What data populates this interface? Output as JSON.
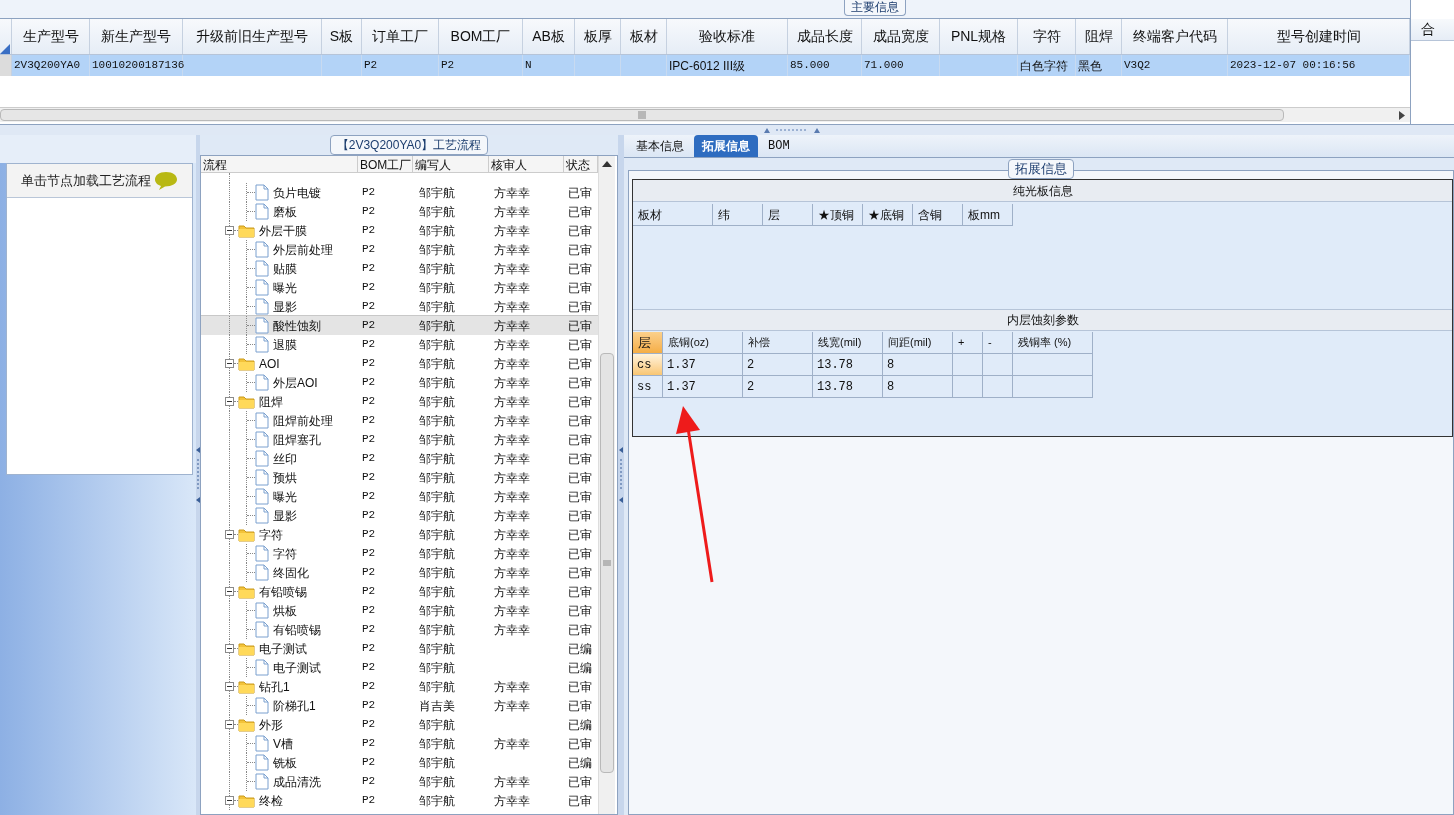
{
  "main_grid": {
    "title": "主要信息",
    "columns": [
      "生产型号",
      "新生产型号",
      "升级前旧生产型号",
      "S板",
      "订单工厂",
      "BOM工厂",
      "AB板",
      "板厚",
      "板材",
      "验收标准",
      "成品长度",
      "成品宽度",
      "PNL规格",
      "字符",
      "阻焊",
      "终端客户代码",
      "型号创建时间"
    ],
    "rows": [
      {
        "selected": true,
        "cells": [
          {
            "text": "2V3Q200YA0"
          },
          {
            "text": "10010200187136"
          },
          {},
          {},
          {
            "text": "P2"
          },
          {
            "text": "P2"
          },
          {
            "text": "N"
          },
          {},
          {},
          {
            "text": "IPC-6012 III级"
          },
          {
            "text": "85.000"
          },
          {
            "text": "71.000"
          },
          {},
          {
            "text": "白色字符"
          },
          {
            "text": "黑色"
          },
          {
            "text": "V3Q2"
          },
          {
            "text": "2023-12-07 00:16:56"
          }
        ]
      }
    ]
  },
  "side_grid": {
    "column_1": "合"
  },
  "process_panel": {
    "title": "【2V3Q200YA0】工艺流程",
    "hint": "单击节点加载工艺流程"
  },
  "tree": {
    "columns": [
      "流程",
      "BOM工厂",
      "编写人",
      "核审人",
      "状态"
    ],
    "nodes": [
      {
        "children": [
          {
            "name": "负片电镀",
            "factory": "P2",
            "writer": "邹宇航",
            "reviewer": "方幸幸",
            "status": "已审",
            "selected": false
          },
          {
            "name": "磨板",
            "factory": "P2",
            "writer": "邹宇航",
            "reviewer": "方幸幸",
            "status": "已审",
            "selected": false
          }
        ]
      },
      {
        "name": "外层干膜",
        "factory": "P2",
        "writer": "邹宇航",
        "reviewer": "方幸幸",
        "status": "已审",
        "selected": false,
        "children": [
          {
            "name": "外层前处理",
            "factory": "P2",
            "writer": "邹宇航",
            "reviewer": "方幸幸",
            "status": "已审",
            "selected": false
          },
          {
            "name": "贴膜",
            "factory": "P2",
            "writer": "邹宇航",
            "reviewer": "方幸幸",
            "status": "已审",
            "selected": false
          },
          {
            "name": "曝光",
            "factory": "P2",
            "writer": "邹宇航",
            "reviewer": "方幸幸",
            "status": "已审",
            "selected": false
          },
          {
            "name": "显影",
            "factory": "P2",
            "writer": "邹宇航",
            "reviewer": "方幸幸",
            "status": "已审",
            "selected": false
          },
          {
            "name": "酸性蚀刻",
            "factory": "P2",
            "writer": "邹宇航",
            "reviewer": "方幸幸",
            "status": "已审",
            "selected": true
          },
          {
            "name": "退膜",
            "factory": "P2",
            "writer": "邹宇航",
            "reviewer": "方幸幸",
            "status": "已审",
            "selected": false
          }
        ]
      },
      {
        "name": "AOI",
        "factory": "P2",
        "writer": "邹宇航",
        "reviewer": "方幸幸",
        "status": "已审",
        "selected": false,
        "children": [
          {
            "name": "外层AOI",
            "factory": "P2",
            "writer": "邹宇航",
            "reviewer": "方幸幸",
            "status": "已审",
            "selected": false
          }
        ]
      },
      {
        "name": "阻焊",
        "factory": "P2",
        "writer": "邹宇航",
        "reviewer": "方幸幸",
        "status": "已审",
        "selected": false,
        "children": [
          {
            "name": "阻焊前处理",
            "factory": "P2",
            "writer": "邹宇航",
            "reviewer": "方幸幸",
            "status": "已审",
            "selected": false
          },
          {
            "name": "阻焊塞孔",
            "factory": "P2",
            "writer": "邹宇航",
            "reviewer": "方幸幸",
            "status": "已审",
            "selected": false
          },
          {
            "name": "丝印",
            "factory": "P2",
            "writer": "邹宇航",
            "reviewer": "方幸幸",
            "status": "已审",
            "selected": false
          },
          {
            "name": "预烘",
            "factory": "P2",
            "writer": "邹宇航",
            "reviewer": "方幸幸",
            "status": "已审",
            "selected": false
          },
          {
            "name": "曝光",
            "factory": "P2",
            "writer": "邹宇航",
            "reviewer": "方幸幸",
            "status": "已审",
            "selected": false
          },
          {
            "name": "显影",
            "factory": "P2",
            "writer": "邹宇航",
            "reviewer": "方幸幸",
            "status": "已审",
            "selected": false
          }
        ]
      },
      {
        "name": "字符",
        "factory": "P2",
        "writer": "邹宇航",
        "reviewer": "方幸幸",
        "status": "已审",
        "selected": false,
        "children": [
          {
            "name": "字符",
            "factory": "P2",
            "writer": "邹宇航",
            "reviewer": "方幸幸",
            "status": "已审",
            "selected": false
          },
          {
            "name": "终固化",
            "factory": "P2",
            "writer": "邹宇航",
            "reviewer": "方幸幸",
            "status": "已审",
            "selected": false
          }
        ]
      },
      {
        "name": "有铅喷锡",
        "factory": "P2",
        "writer": "邹宇航",
        "reviewer": "方幸幸",
        "status": "已审",
        "selected": false,
        "children": [
          {
            "name": "烘板",
            "factory": "P2",
            "writer": "邹宇航",
            "reviewer": "方幸幸",
            "status": "已审",
            "selected": false
          },
          {
            "name": "有铅喷锡",
            "factory": "P2",
            "writer": "邹宇航",
            "reviewer": "方幸幸",
            "status": "已审",
            "selected": false
          }
        ]
      },
      {
        "name": "电子测试",
        "factory": "P2",
        "writer": "邹宇航",
        "status": "已编",
        "selected": false,
        "children": [
          {
            "name": "电子测试",
            "factory": "P2",
            "writer": "邹宇航",
            "status": "已编",
            "selected": false
          }
        ]
      },
      {
        "name": "钻孔1",
        "factory": "P2",
        "writer": "邹宇航",
        "reviewer": "方幸幸",
        "status": "已审",
        "selected": false,
        "children": [
          {
            "name": "阶梯孔1",
            "factory": "P2",
            "writer": "肖吉美",
            "reviewer": "方幸幸",
            "status": "已审",
            "selected": false
          }
        ]
      },
      {
        "name": "外形",
        "factory": "P2",
        "writer": "邹宇航",
        "status": "已编",
        "selected": false,
        "children": [
          {
            "name": "V槽",
            "factory": "P2",
            "writer": "邹宇航",
            "reviewer": "方幸幸",
            "status": "已审",
            "selected": false
          },
          {
            "name": "铣板",
            "factory": "P2",
            "writer": "邹宇航",
            "status": "已编",
            "selected": false
          },
          {
            "name": "成品清洗",
            "factory": "P2",
            "writer": "邹宇航",
            "reviewer": "方幸幸",
            "status": "已审",
            "selected": false
          }
        ]
      },
      {
        "name": "终检",
        "factory": "P2",
        "writer": "邹宇航",
        "reviewer": "方幸幸",
        "status": "已审",
        "selected": false
      }
    ]
  },
  "detail": {
    "tabs": [
      {
        "label": "基本信息",
        "selected": false
      },
      {
        "label": "拓展信息",
        "selected": true
      },
      {
        "label": "BOM",
        "selected": false
      }
    ],
    "group_title": "拓展信息",
    "plain_board": {
      "title": "纯光板信息",
      "columns": [
        "板材",
        "纬",
        "层",
        "★顶铜",
        "★底铜",
        "含铜",
        "板mm"
      ]
    },
    "inner_etch": {
      "title": "内层蚀刻参数",
      "columns": [
        "层",
        "底铜(oz)",
        "补偿",
        "线宽(mil)",
        "间距(mil)",
        "+",
        "-",
        "残铜率 (%)"
      ],
      "rows": [
        {
          "selected": true,
          "cells": [
            {
              "text": "cs"
            },
            {
              "text": "1.37"
            },
            {
              "text": "2"
            },
            {
              "text": "13.78"
            },
            {
              "text": "8"
            },
            {},
            {},
            {}
          ]
        },
        {
          "selected": false,
          "cells": [
            {
              "text": "ss"
            },
            {
              "text": "1.37"
            },
            {
              "text": "2"
            },
            {
              "text": "13.78"
            },
            {
              "text": "8"
            },
            {},
            {},
            {}
          ]
        }
      ]
    }
  }
}
